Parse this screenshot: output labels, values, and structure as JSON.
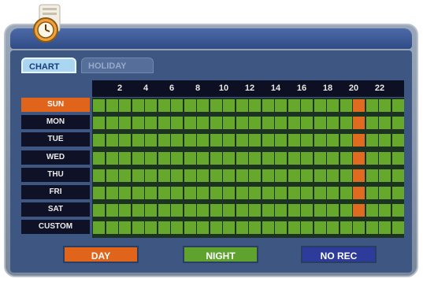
{
  "window": {
    "title": "SCHEDULE"
  },
  "tabs": [
    {
      "label": "CHART",
      "active": true
    },
    {
      "label": "HOLIDAY",
      "active": false
    }
  ],
  "hour_labels": [
    "2",
    "4",
    "6",
    "8",
    "10",
    "12",
    "14",
    "16",
    "18",
    "20",
    "22"
  ],
  "days": [
    {
      "label": "SUN",
      "selected": true
    },
    {
      "label": "MON",
      "selected": false
    },
    {
      "label": "TUE",
      "selected": false
    },
    {
      "label": "WED",
      "selected": false
    },
    {
      "label": "THU",
      "selected": false
    },
    {
      "label": "FRI",
      "selected": false
    },
    {
      "label": "SAT",
      "selected": false
    },
    {
      "label": "CUSTOM",
      "selected": false
    }
  ],
  "schedule": {
    "day_mode_hour": 20,
    "day_mode_rows": [
      "SUN",
      "MON",
      "TUE",
      "WED",
      "THU",
      "FRI",
      "SAT"
    ]
  },
  "legend": {
    "day_label": "DAY",
    "night_label": "NIGHT",
    "norec_label": "NO REC"
  },
  "colors": {
    "day": "#e0651a",
    "night": "#66a82c",
    "no_rec": "#2d3b9a"
  }
}
